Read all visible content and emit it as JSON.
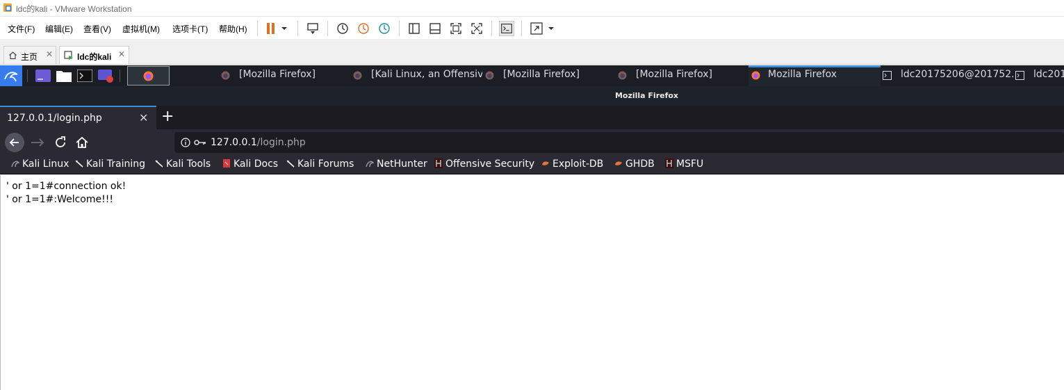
{
  "vmware": {
    "title": "ldc的kali - VMware Workstation",
    "menu": [
      "文件(F)",
      "编辑(E)",
      "查看(V)",
      "虚拟机(M)",
      "选项卡(T)",
      "帮助(H)"
    ],
    "tabs": [
      {
        "label": "主页"
      },
      {
        "label": "ldc的kali"
      }
    ]
  },
  "kali_panel": {
    "tasks": [
      {
        "label": "[Mozilla Firefox]"
      },
      {
        "label": "[Kali Linux, an Offensiv..."
      },
      {
        "label": "[Mozilla Firefox]"
      },
      {
        "label": "[Mozilla Firefox]"
      },
      {
        "label": "Mozilla Firefox"
      },
      {
        "label": "ldc20175206@201752..."
      },
      {
        "label": "ldc201"
      }
    ]
  },
  "window": {
    "title": "Mozilla Firefox"
  },
  "firefox": {
    "tab_title": "127.0.0.1/login.php",
    "url_host": "127.0.0.1",
    "url_path": "/login.php",
    "bookmarks": [
      "Kali Linux",
      "Kali Training",
      "Kali Tools",
      "Kali Docs",
      "Kali Forums",
      "NetHunter",
      "Offensive Security",
      "Exploit-DB",
      "GHDB",
      "MSFU"
    ]
  },
  "page": {
    "lines": [
      "' or 1=1#connection ok!",
      "' or 1=1#:Welcome!!!"
    ]
  },
  "colors": {
    "panel_bg": "#1b1f25",
    "firefox_chrome": "#2b2a33",
    "accent_blue": "#3d8ee0",
    "vmware_orange": "#e07020"
  }
}
